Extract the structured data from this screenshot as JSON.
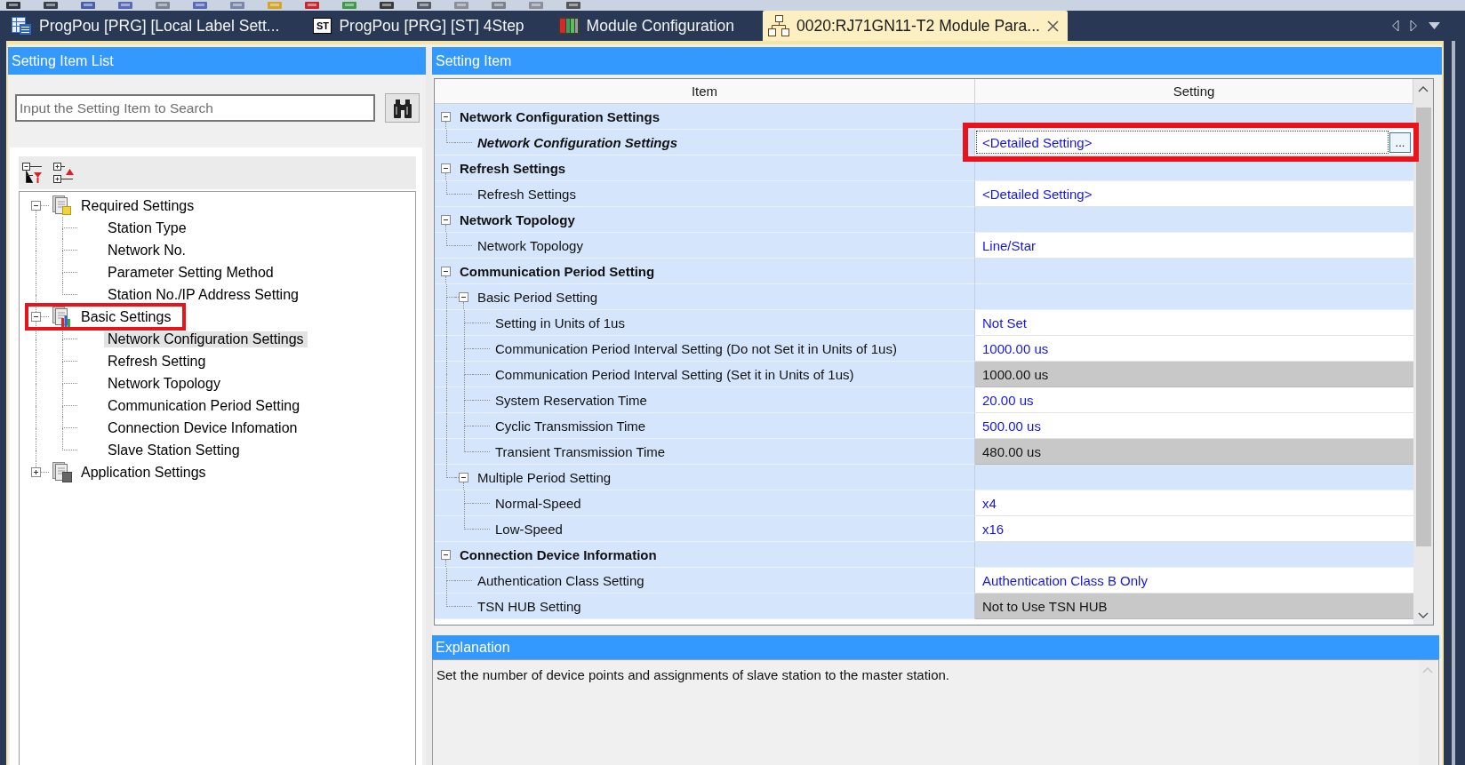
{
  "tabs": [
    {
      "kind": "labels",
      "label": "ProgPou [PRG] [Local Label Sett...",
      "selected": false
    },
    {
      "kind": "program",
      "icon_text": "ST",
      "label": "ProgPou [PRG] [ST] 4Step",
      "selected": false
    },
    {
      "kind": "configuration",
      "label": "Module Configuration",
      "selected": false
    },
    {
      "kind": "parameter",
      "label": "0020:RJ71GN11-T2 Module Para...",
      "selected": true
    }
  ],
  "setting_item_list": {
    "title": "Setting Item List",
    "search": {
      "placeholder": "Input the Setting Item to Search"
    },
    "tree": [
      {
        "label": "Required Settings",
        "expanded": true,
        "selected": false,
        "boxed": false,
        "children": [
          {
            "label": "Station Type",
            "selected": false,
            "boxed": false
          },
          {
            "label": "Network No.",
            "selected": false,
            "boxed": false
          },
          {
            "label": "Parameter Setting Method",
            "selected": false,
            "boxed": false
          },
          {
            "label": "Station No./IP Address Setting",
            "selected": false,
            "boxed": false
          }
        ]
      },
      {
        "label": "Basic Settings",
        "expanded": true,
        "selected": false,
        "boxed": true,
        "children": [
          {
            "label": "Network Configuration Settings",
            "selected": true,
            "boxed": false
          },
          {
            "label": "Refresh Setting",
            "selected": false,
            "boxed": false
          },
          {
            "label": "Network Topology",
            "selected": false,
            "boxed": false
          },
          {
            "label": "Communication Period Setting",
            "selected": false,
            "boxed": false
          },
          {
            "label": "Connection Device Infomation",
            "selected": false,
            "boxed": false
          },
          {
            "label": "Slave Station Setting",
            "selected": false,
            "boxed": false
          }
        ]
      },
      {
        "label": "Application Settings",
        "expanded": false,
        "selected": false,
        "boxed": false
      }
    ]
  },
  "setting_item": {
    "title": "Setting Item",
    "columns": [
      "Item",
      "Setting"
    ],
    "rows": [
      {
        "kind": "group",
        "label": "Network Configuration Settings",
        "expanded": true,
        "selected": false,
        "boxed": false,
        "children": [
          {
            "kind": "item",
            "label": "Network Configuration Settings",
            "value": "<Detailed Setting>",
            "browse_button": "...",
            "disabled": false,
            "selected": true,
            "boxed": true
          }
        ]
      },
      {
        "kind": "group",
        "label": "Refresh Settings",
        "expanded": true,
        "selected": false,
        "boxed": false,
        "children": [
          {
            "kind": "item",
            "label": "Refresh Settings",
            "value": "<Detailed Setting>",
            "disabled": false,
            "selected": false,
            "boxed": false
          }
        ]
      },
      {
        "kind": "group",
        "label": "Network Topology",
        "expanded": true,
        "selected": false,
        "boxed": false,
        "children": [
          {
            "kind": "item",
            "label": "Network Topology",
            "value": "Line/Star",
            "disabled": false,
            "selected": false,
            "boxed": false
          }
        ]
      },
      {
        "kind": "group",
        "label": "Communication Period Setting",
        "expanded": true,
        "selected": false,
        "boxed": false,
        "children": [
          {
            "kind": "group",
            "label": "Basic Period Setting",
            "expanded": true,
            "selected": false,
            "boxed": false,
            "children": [
              {
                "kind": "item",
                "label": "Setting in Units of 1us",
                "value": "Not Set",
                "disabled": false,
                "selected": false,
                "boxed": false
              },
              {
                "kind": "item",
                "label": "Communication Period Interval Setting (Do not Set it in Units of 1us)",
                "value": "1000.00 us",
                "disabled": false,
                "selected": false,
                "boxed": false
              },
              {
                "kind": "item",
                "label": "Communication Period Interval Setting (Set it in Units of 1us)",
                "value": "1000.00 us",
                "disabled": true,
                "selected": false,
                "boxed": false
              },
              {
                "kind": "item",
                "label": "System Reservation Time",
                "value": "20.00 us",
                "disabled": false,
                "selected": false,
                "boxed": false
              },
              {
                "kind": "item",
                "label": "Cyclic Transmission Time",
                "value": "500.00 us",
                "disabled": false,
                "selected": false,
                "boxed": false
              },
              {
                "kind": "item",
                "label": "Transient Transmission Time",
                "value": "480.00 us",
                "disabled": true,
                "selected": false,
                "boxed": false
              }
            ]
          },
          {
            "kind": "group",
            "label": "Multiple Period Setting",
            "expanded": true,
            "selected": false,
            "boxed": false,
            "children": [
              {
                "kind": "item",
                "label": "Normal-Speed",
                "value": "x4",
                "disabled": false,
                "selected": false,
                "boxed": false
              },
              {
                "kind": "item",
                "label": "Low-Speed",
                "value": "x16",
                "disabled": false,
                "selected": false,
                "boxed": false
              }
            ]
          }
        ]
      },
      {
        "kind": "group",
        "label": "Connection Device Information",
        "expanded": true,
        "selected": false,
        "boxed": false,
        "children": [
          {
            "kind": "item",
            "label": "Authentication Class Setting",
            "value": "Authentication Class B Only",
            "disabled": false,
            "selected": false,
            "boxed": false
          },
          {
            "kind": "item",
            "label": "TSN HUB Setting",
            "value": "Not to Use TSN HUB",
            "disabled": true,
            "selected": false,
            "boxed": false
          }
        ]
      }
    ]
  },
  "explanation": {
    "title": "Explanation",
    "text": "Set the number of device points and assignments of slave station to the master station."
  }
}
